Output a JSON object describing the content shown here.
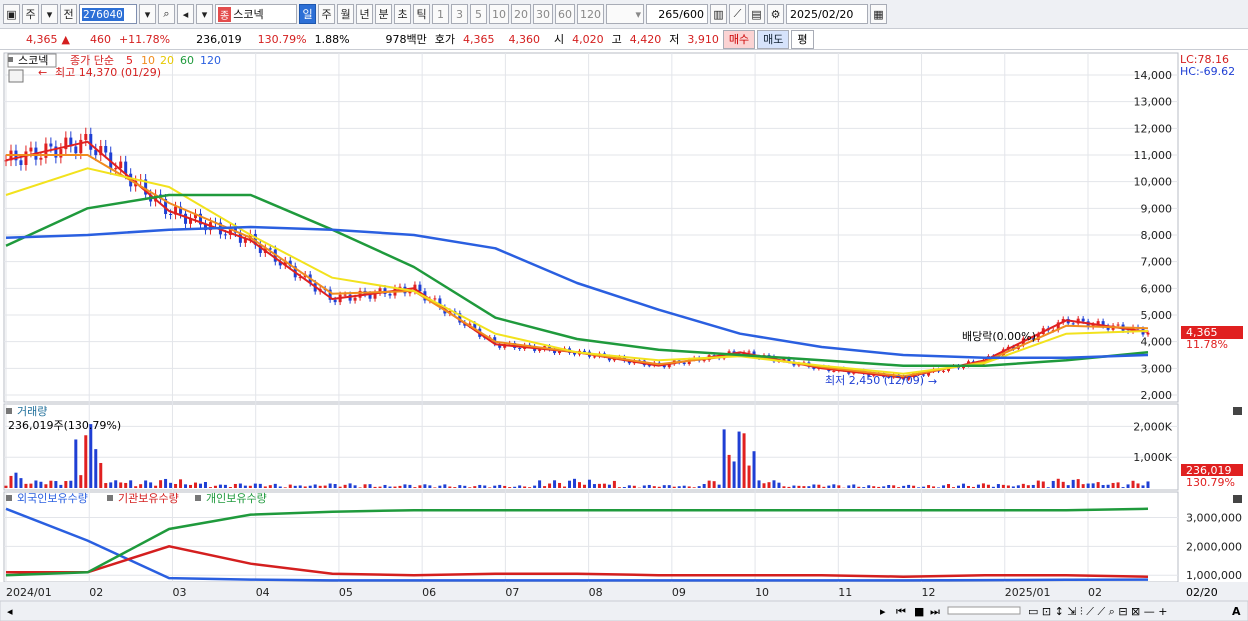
{
  "toolbar": {
    "period_tabs": [
      "주",
      "전"
    ],
    "code": "276040",
    "stock_name": "스코넥",
    "name_tag": "종",
    "interval_tabs": [
      "일",
      "주",
      "월",
      "년",
      "분",
      "초",
      "틱"
    ],
    "minute_tabs": [
      "1",
      "3",
      "5",
      "10",
      "20",
      "30",
      "60",
      "120"
    ],
    "count": "265",
    "count_total": "/600",
    "date": "2025/02/20"
  },
  "quote": {
    "price": "4,365",
    "change": "460",
    "change_pct": "+11.78%",
    "volume": "236,019",
    "volume_ratio": "130.79%",
    "turnover": "1.88%",
    "amount": "978백만",
    "hoga_label": "호가",
    "ask": "4,365",
    "bid": "4,360",
    "open_label": "시",
    "open": "4,020",
    "high_label": "고",
    "high": "4,420",
    "low_label": "저",
    "low": "3,910",
    "buy_btn": "매수",
    "sell_btn": "매도",
    "eval_btn": "평"
  },
  "price_panel": {
    "name_tag": "스코넥",
    "ma_label": "종가 단순",
    "ma_periods": [
      "5",
      "10",
      "20",
      "60",
      "120"
    ],
    "max_note": "최고 14,370 (01/29)",
    "min_note": "최저 2,450 (12/09)",
    "dividend_note": "배당락(0.00%)",
    "lc": "LC:78.16",
    "hc": "HC:-69.62",
    "last_price_tag": "4,365",
    "last_pct_tag": "11.78%",
    "y_ticks": [
      "14,000",
      "13,000",
      "12,000",
      "11,000",
      "10,000",
      "9,000",
      "8,000",
      "7,000",
      "6,000",
      "5,000",
      "4,000",
      "3,000",
      "2,000"
    ]
  },
  "volume_panel": {
    "title": "거래량",
    "subtitle": "236,019주(130.79%)",
    "y_ticks": [
      "2,000K",
      "1,000K"
    ],
    "last_tag": "236,019",
    "last_pct_tag": "130.79%"
  },
  "holding_panel": {
    "legend": [
      "외국인보유수량",
      "기관보유수량",
      "개인보유수량"
    ],
    "y_ticks": [
      "3,000,000",
      "2,000,000",
      "1,000,000"
    ]
  },
  "x_axis": {
    "labels": [
      "2024/01",
      "02",
      "03",
      "04",
      "05",
      "06",
      "07",
      "08",
      "09",
      "10",
      "11",
      "12",
      "2025/01",
      "02"
    ],
    "right_label": "02/20"
  },
  "colors": {
    "up": "#e02020",
    "down": "#1f3fd4",
    "ma5": "#e02020",
    "ma10": "#f08c1e",
    "ma20": "#f2e21d",
    "ma60": "#1f9a3c",
    "ma120": "#2a5fe0",
    "foreign": "#2a5fe0",
    "inst": "#d41f1f",
    "retail": "#1f9a3c"
  },
  "chart_data": [
    {
      "type": "line",
      "title": "스코넥",
      "ylim": [
        2000,
        14000
      ],
      "x": [
        "2024/01",
        "02",
        "03",
        "04",
        "05",
        "06",
        "07",
        "08",
        "09",
        "10",
        "11",
        "12",
        "2025/01",
        "02",
        "02/20"
      ],
      "series": [
        {
          "name": "5",
          "values": [
            10800,
            11500,
            8900,
            7800,
            5600,
            6000,
            3900,
            3600,
            3100,
            3600,
            3000,
            2650,
            3300,
            4800,
            4365
          ]
        },
        {
          "name": "10",
          "values": [
            11000,
            11000,
            9200,
            7900,
            5800,
            5900,
            4000,
            3600,
            3150,
            3500,
            3050,
            2700,
            3250,
            4600,
            4500
          ]
        },
        {
          "name": "20",
          "values": [
            9500,
            10500,
            9800,
            8000,
            6400,
            5900,
            4300,
            3600,
            3300,
            3450,
            3100,
            2800,
            3200,
            4300,
            4400
          ]
        },
        {
          "name": "60",
          "values": [
            7600,
            9000,
            9500,
            9500,
            8200,
            6800,
            4900,
            4100,
            3700,
            3500,
            3300,
            3100,
            3100,
            3300,
            3600
          ]
        },
        {
          "name": "120",
          "values": [
            7900,
            8000,
            8200,
            8300,
            8200,
            8000,
            7500,
            6200,
            5200,
            4300,
            3800,
            3500,
            3400,
            3400,
            3500
          ]
        }
      ]
    },
    {
      "type": "bar",
      "title": "거래량",
      "ylim": [
        0,
        2500
      ],
      "x": [
        "2024/01",
        "02",
        "03",
        "04",
        "05",
        "06",
        "07",
        "08",
        "09",
        "10",
        "11",
        "12",
        "2025/01",
        "02",
        "02/20"
      ],
      "values": [
        500,
        2100,
        300,
        150,
        150,
        120,
        100,
        300,
        100,
        1950,
        120,
        100,
        150,
        300,
        236
      ]
    },
    {
      "type": "line",
      "title": "보유수량",
      "ylim": [
        800000,
        3500000
      ],
      "x": [
        "2024/01",
        "02",
        "03",
        "04",
        "05",
        "06",
        "07",
        "08",
        "09",
        "10",
        "11",
        "12",
        "2025/01",
        "02",
        "02/20"
      ],
      "series": [
        {
          "name": "외국인보유수량",
          "values": [
            3300000,
            2200000,
            900000,
            850000,
            820000,
            820000,
            820000,
            820000,
            820000,
            820000,
            820000,
            820000,
            830000,
            840000,
            850000
          ]
        },
        {
          "name": "기관보유수량",
          "values": [
            1100000,
            1100000,
            2000000,
            1400000,
            1050000,
            1000000,
            1050000,
            1050000,
            1000000,
            1000000,
            1000000,
            950000,
            1000000,
            1000000,
            950000
          ]
        },
        {
          "name": "개인보유수량",
          "values": [
            1000000,
            1100000,
            2600000,
            3100000,
            3200000,
            3250000,
            3250000,
            3250000,
            3250000,
            3250000,
            3250000,
            3250000,
            3250000,
            3250000,
            3300000
          ]
        }
      ]
    }
  ]
}
